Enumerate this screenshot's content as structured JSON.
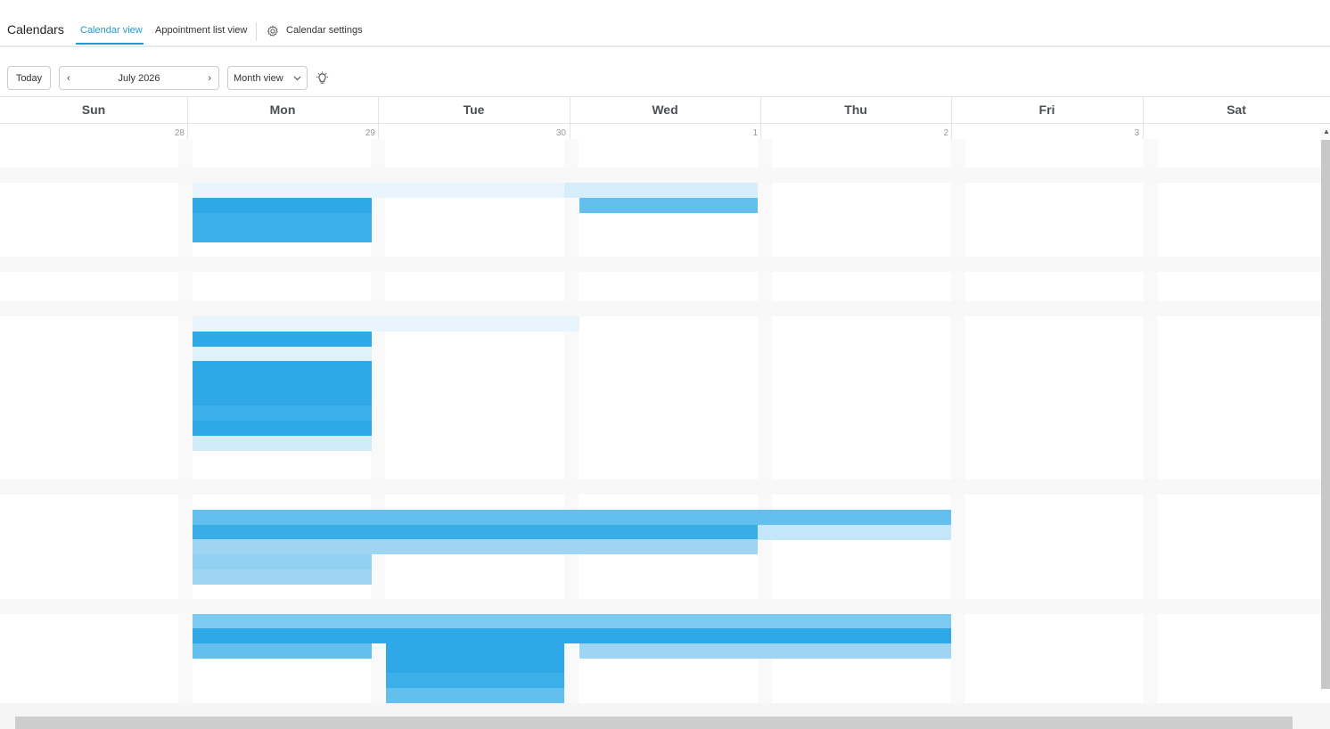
{
  "header": {
    "title": "Calendars",
    "tabs": [
      {
        "label": "Calendar view",
        "active": true
      },
      {
        "label": "Appointment list view",
        "active": false
      },
      {
        "label": "Calendar settings",
        "active": false,
        "icon": "gear-icon"
      }
    ]
  },
  "toolbar": {
    "today_label": "Today",
    "month_label": "July 2026",
    "prev_icon": "chevron-left-icon",
    "next_icon": "chevron-right-icon",
    "view_label": "Month view",
    "view_icon": "chevron-down-icon",
    "tips_icon": "lightbulb-icon"
  },
  "calendar": {
    "weekdays": [
      "Sun",
      "Mon",
      "Tue",
      "Wed",
      "Thu",
      "Fri",
      "Sat"
    ],
    "first_row_dates": [
      "28",
      "29",
      "30",
      "1",
      "2",
      "3"
    ]
  },
  "colors": {
    "accent": "#1e9bd7",
    "event": "#2ea8e6",
    "event_light": "#9fd5f3"
  }
}
